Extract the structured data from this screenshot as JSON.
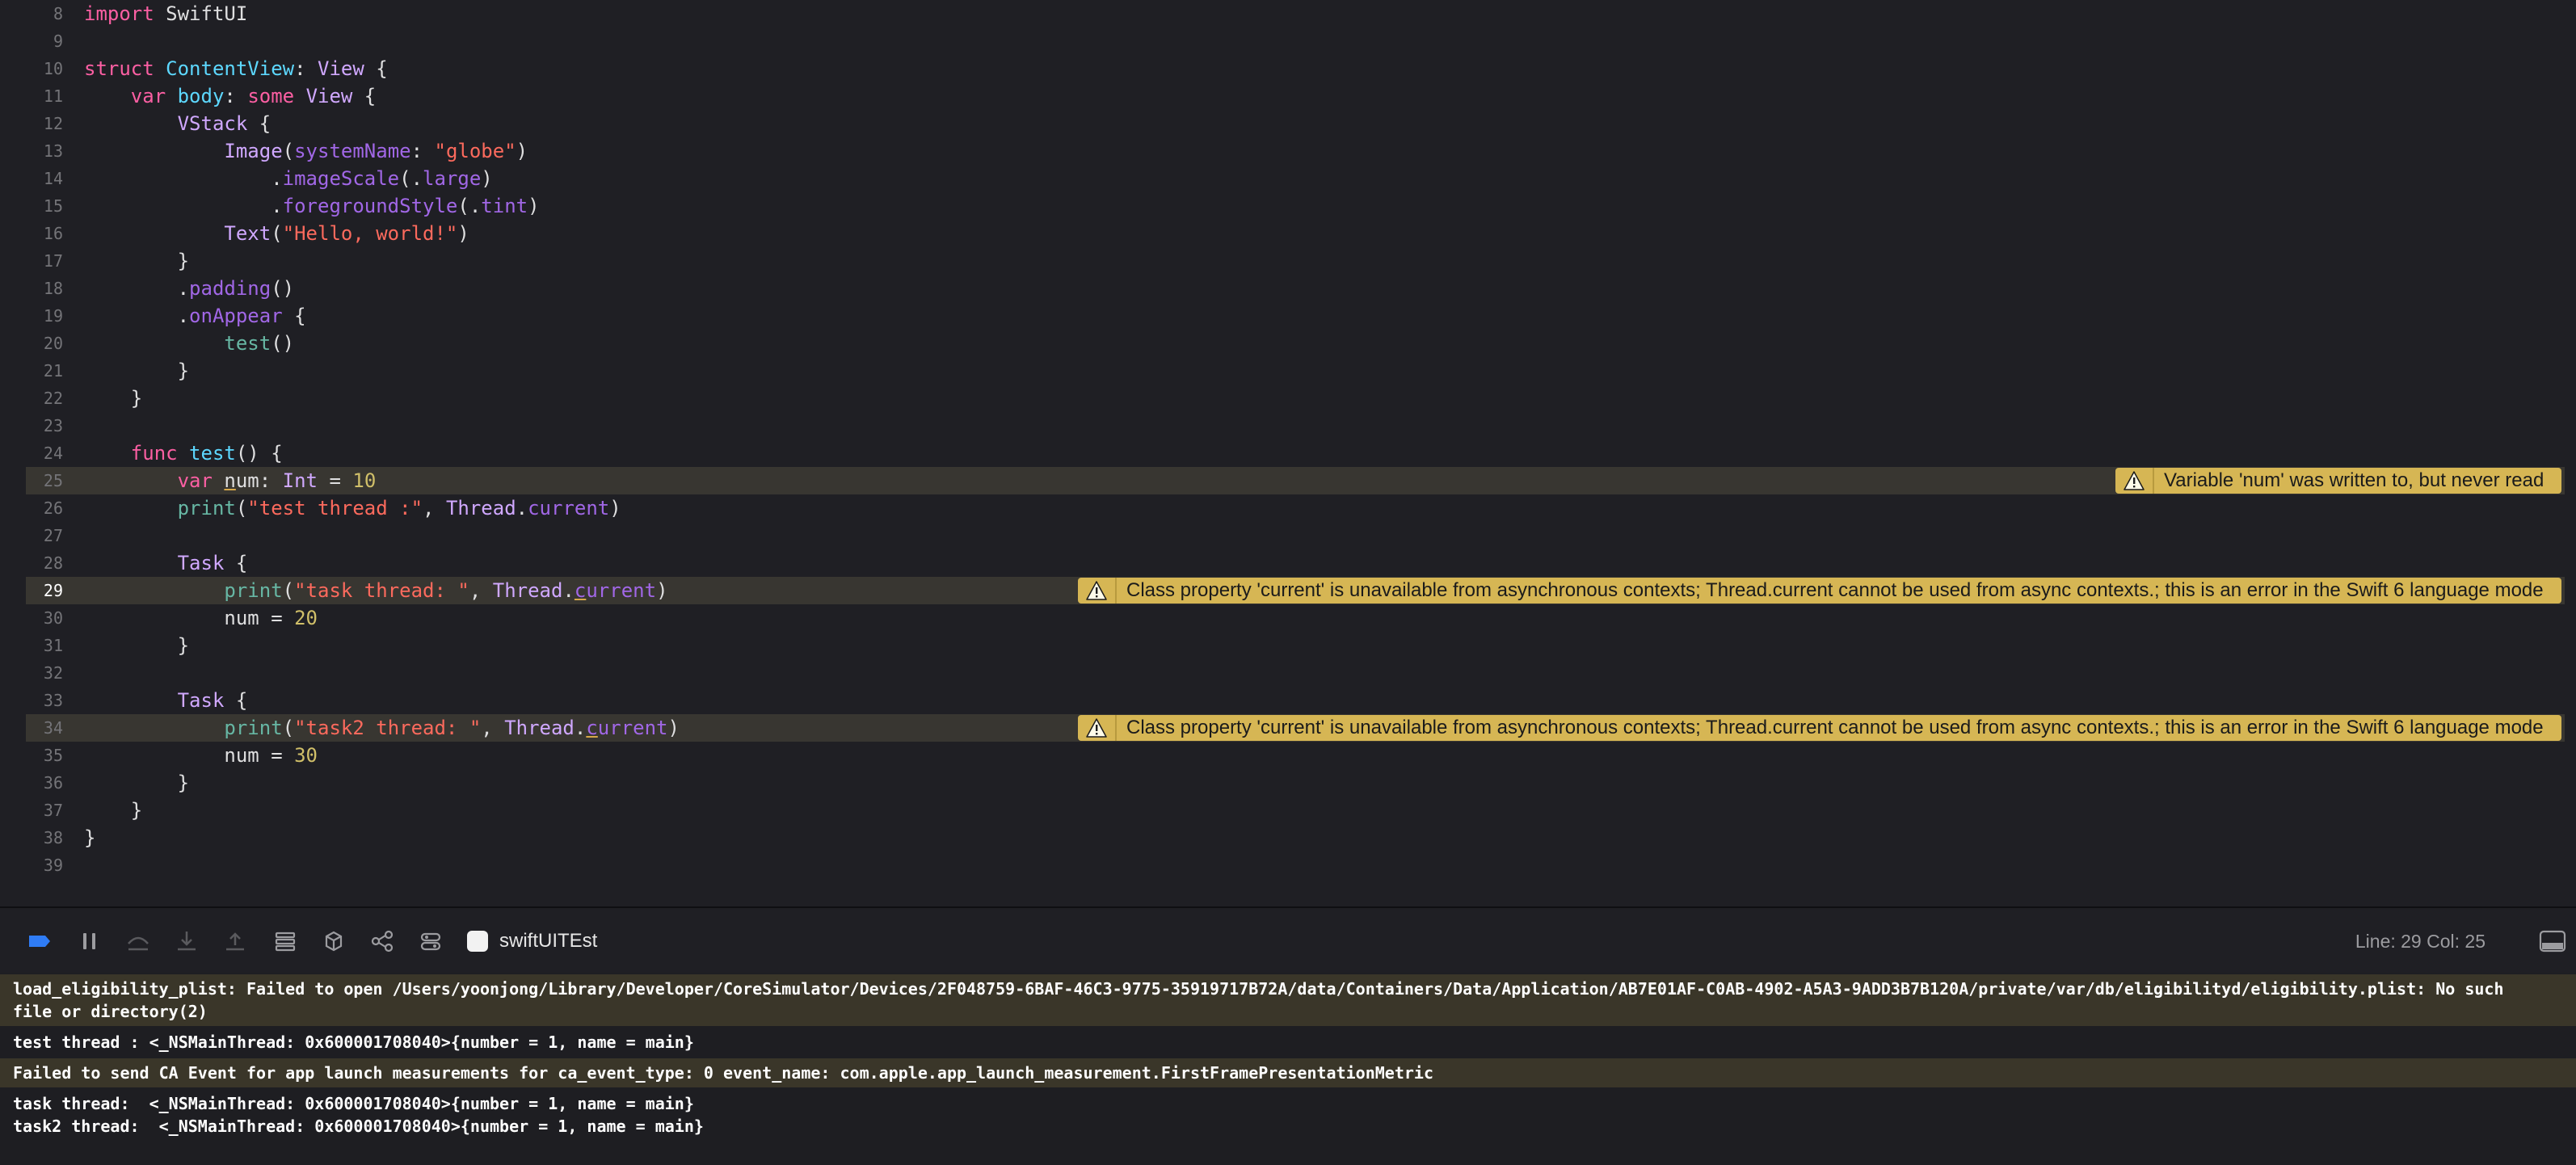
{
  "editor": {
    "lines": [
      {
        "n": "8",
        "tokens": [
          {
            "c": "kw",
            "t": "import"
          },
          {
            "c": "",
            "t": " SwiftUI"
          }
        ]
      },
      {
        "n": "9",
        "tokens": []
      },
      {
        "n": "10",
        "tokens": [
          {
            "c": "kw",
            "t": "struct"
          },
          {
            "c": "",
            "t": " "
          },
          {
            "c": "dec",
            "t": "ContentView"
          },
          {
            "c": "",
            "t": ": "
          },
          {
            "c": "ty",
            "t": "View"
          },
          {
            "c": "",
            "t": " {"
          }
        ]
      },
      {
        "n": "11",
        "tokens": [
          {
            "c": "",
            "t": "    "
          },
          {
            "c": "kw",
            "t": "var"
          },
          {
            "c": "",
            "t": " "
          },
          {
            "c": "dec",
            "t": "body"
          },
          {
            "c": "",
            "t": ": "
          },
          {
            "c": "kw",
            "t": "some"
          },
          {
            "c": "",
            "t": " "
          },
          {
            "c": "ty",
            "t": "View"
          },
          {
            "c": "",
            "t": " {"
          }
        ]
      },
      {
        "n": "12",
        "tokens": [
          {
            "c": "",
            "t": "        "
          },
          {
            "c": "ty",
            "t": "VStack"
          },
          {
            "c": "",
            "t": " {"
          }
        ]
      },
      {
        "n": "13",
        "tokens": [
          {
            "c": "",
            "t": "            "
          },
          {
            "c": "ty",
            "t": "Image"
          },
          {
            "c": "",
            "t": "("
          },
          {
            "c": "mem",
            "t": "systemName"
          },
          {
            "c": "",
            "t": ": "
          },
          {
            "c": "str",
            "t": "\"globe\""
          },
          {
            "c": "",
            "t": ")"
          }
        ]
      },
      {
        "n": "14",
        "tokens": [
          {
            "c": "",
            "t": "                ."
          },
          {
            "c": "mem",
            "t": "imageScale"
          },
          {
            "c": "",
            "t": "(."
          },
          {
            "c": "mem",
            "t": "large"
          },
          {
            "c": "",
            "t": ")"
          }
        ]
      },
      {
        "n": "15",
        "tokens": [
          {
            "c": "",
            "t": "                ."
          },
          {
            "c": "mem",
            "t": "foregroundStyle"
          },
          {
            "c": "",
            "t": "(."
          },
          {
            "c": "mem",
            "t": "tint"
          },
          {
            "c": "",
            "t": ")"
          }
        ]
      },
      {
        "n": "16",
        "tokens": [
          {
            "c": "",
            "t": "            "
          },
          {
            "c": "ty",
            "t": "Text"
          },
          {
            "c": "",
            "t": "("
          },
          {
            "c": "str",
            "t": "\"Hello, world!\""
          },
          {
            "c": "",
            "t": ")"
          }
        ]
      },
      {
        "n": "17",
        "tokens": [
          {
            "c": "",
            "t": "        }"
          }
        ]
      },
      {
        "n": "18",
        "tokens": [
          {
            "c": "",
            "t": "        ."
          },
          {
            "c": "mem",
            "t": "padding"
          },
          {
            "c": "",
            "t": "()"
          }
        ]
      },
      {
        "n": "19",
        "tokens": [
          {
            "c": "",
            "t": "        ."
          },
          {
            "c": "mem",
            "t": "onAppear"
          },
          {
            "c": "",
            "t": " {"
          }
        ]
      },
      {
        "n": "20",
        "tokens": [
          {
            "c": "",
            "t": "            "
          },
          {
            "c": "fn",
            "t": "test"
          },
          {
            "c": "",
            "t": "()"
          }
        ]
      },
      {
        "n": "21",
        "tokens": [
          {
            "c": "",
            "t": "        }"
          }
        ]
      },
      {
        "n": "22",
        "tokens": [
          {
            "c": "",
            "t": "    }"
          }
        ]
      },
      {
        "n": "23",
        "tokens": []
      },
      {
        "n": "24",
        "tokens": [
          {
            "c": "",
            "t": "    "
          },
          {
            "c": "kw",
            "t": "func"
          },
          {
            "c": "",
            "t": " "
          },
          {
            "c": "dec",
            "t": "test"
          },
          {
            "c": "",
            "t": "() {"
          }
        ]
      },
      {
        "n": "25",
        "hl": true,
        "tokens": [
          {
            "c": "",
            "t": "        "
          },
          {
            "c": "kw",
            "t": "var"
          },
          {
            "c": "",
            "t": " "
          },
          {
            "c": "u",
            "t": "n"
          },
          {
            "c": "",
            "t": "um: "
          },
          {
            "c": "ty",
            "t": "Int"
          },
          {
            "c": "",
            "t": " = "
          },
          {
            "c": "num",
            "t": "10"
          }
        ],
        "warning": "Variable 'num' was written to, but never read"
      },
      {
        "n": "26",
        "tokens": [
          {
            "c": "",
            "t": "        "
          },
          {
            "c": "fn",
            "t": "print"
          },
          {
            "c": "",
            "t": "("
          },
          {
            "c": "str",
            "t": "\"test thread :\""
          },
          {
            "c": "",
            "t": ", "
          },
          {
            "c": "ty",
            "t": "Thread"
          },
          {
            "c": "",
            "t": "."
          },
          {
            "c": "mem",
            "t": "current"
          },
          {
            "c": "",
            "t": ")"
          }
        ]
      },
      {
        "n": "27",
        "tokens": []
      },
      {
        "n": "28",
        "tokens": [
          {
            "c": "",
            "t": "        "
          },
          {
            "c": "ty",
            "t": "Task"
          },
          {
            "c": "",
            "t": " {"
          }
        ]
      },
      {
        "n": "29",
        "hl": true,
        "cur": true,
        "tokens": [
          {
            "c": "",
            "t": "            "
          },
          {
            "c": "fn",
            "t": "print"
          },
          {
            "c": "",
            "t": "("
          },
          {
            "c": "str",
            "t": "\"task thread: \""
          },
          {
            "c": "",
            "t": ", "
          },
          {
            "c": "ty",
            "t": "Thread"
          },
          {
            "c": "",
            "t": "."
          },
          {
            "c": "mem u",
            "t": "c"
          },
          {
            "c": "mem",
            "t": "urrent"
          },
          {
            "c": "",
            "t": ")"
          }
        ],
        "warning": "Class property 'current' is unavailable from asynchronous contexts; Thread.current cannot be used from async contexts.; this is an error in the Swift 6 language mode"
      },
      {
        "n": "30",
        "tokens": [
          {
            "c": "",
            "t": "            num = "
          },
          {
            "c": "num",
            "t": "20"
          }
        ]
      },
      {
        "n": "31",
        "tokens": [
          {
            "c": "",
            "t": "        }"
          }
        ]
      },
      {
        "n": "32",
        "tokens": []
      },
      {
        "n": "33",
        "tokens": [
          {
            "c": "",
            "t": "        "
          },
          {
            "c": "ty",
            "t": "Task"
          },
          {
            "c": "",
            "t": " {"
          }
        ]
      },
      {
        "n": "34",
        "hl": true,
        "tokens": [
          {
            "c": "",
            "t": "            "
          },
          {
            "c": "fn",
            "t": "print"
          },
          {
            "c": "",
            "t": "("
          },
          {
            "c": "str",
            "t": "\"task2 thread: \""
          },
          {
            "c": "",
            "t": ", "
          },
          {
            "c": "ty",
            "t": "Thread"
          },
          {
            "c": "",
            "t": "."
          },
          {
            "c": "mem u",
            "t": "c"
          },
          {
            "c": "mem",
            "t": "urrent"
          },
          {
            "c": "",
            "t": ")"
          }
        ],
        "warning": "Class property 'current' is unavailable from asynchronous contexts; Thread.current cannot be used from async contexts.; this is an error in the Swift 6 language mode"
      },
      {
        "n": "35",
        "tokens": [
          {
            "c": "",
            "t": "            num = "
          },
          {
            "c": "num",
            "t": "30"
          }
        ]
      },
      {
        "n": "36",
        "tokens": [
          {
            "c": "",
            "t": "        }"
          }
        ]
      },
      {
        "n": "37",
        "tokens": [
          {
            "c": "",
            "t": "    }"
          }
        ]
      },
      {
        "n": "38",
        "tokens": [
          {
            "c": "",
            "t": "}"
          }
        ]
      },
      {
        "n": "39",
        "tokens": []
      }
    ]
  },
  "debugbar": {
    "scheme_name": "swiftUITEst",
    "cursor_position": "Line: 29  Col: 25",
    "icons": [
      "breakpoints-toggle-icon",
      "pause-icon",
      "step-over-icon",
      "step-into-icon",
      "step-out-icon",
      "view-hierarchy-icon",
      "memory-graph-icon",
      "environment-overrides-icon",
      "simulate-location-icon"
    ]
  },
  "console": {
    "messages": [
      {
        "warn": true,
        "text": "load_eligibility_plist: Failed to open /Users/yoonjong/Library/Developer/CoreSimulator/Devices/2F048759-6BAF-46C3-9775-35919717B72A/data/Containers/Data/Application/AB7E01AF-C0AB-4902-A5A3-9ADD3B7B120A/private/var/db/eligibilityd/eligibility.plist: No such file or directory(2)"
      },
      {
        "warn": false,
        "text": "test thread : <_NSMainThread: 0x600001708040>{number = 1, name = main}"
      },
      {
        "warn": true,
        "text": "Failed to send CA Event for app launch measurements for ca_event_type: 0 event_name: com.apple.app_launch_measurement.FirstFramePresentationMetric"
      },
      {
        "warn": false,
        "text": "task thread:  <_NSMainThread: 0x600001708040>{number = 1, name = main}\ntask2 thread:  <_NSMainThread: 0x600001708040>{number = 1, name = main}"
      }
    ]
  }
}
